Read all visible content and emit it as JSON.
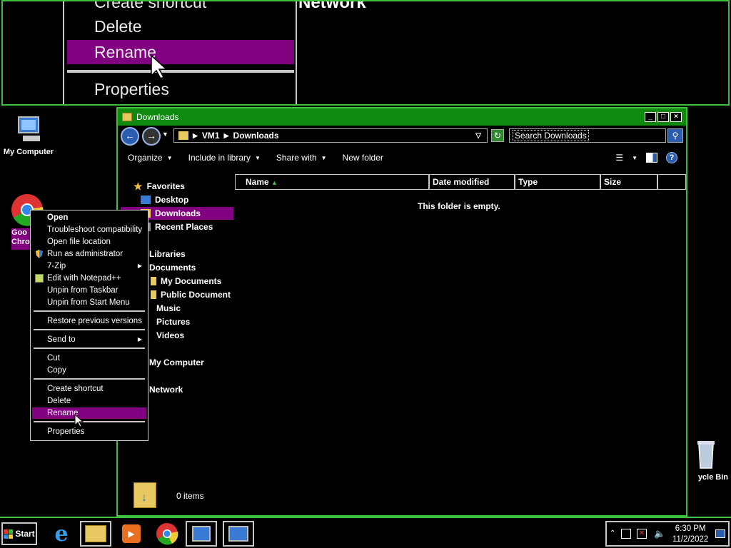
{
  "magnifier": {
    "items": [
      "Create shortcut",
      "Delete",
      "Rename",
      "Properties"
    ],
    "right_text": "Network"
  },
  "desktop": {
    "my_computer": "My Computer",
    "chrome_label": "Goo\nChro",
    "recycle_bin": "ycle Bin"
  },
  "window": {
    "title": "Downloads",
    "buttons": [
      "_",
      "□",
      "×"
    ],
    "address": {
      "root": "VM1",
      "folder": "Downloads"
    },
    "search_placeholder": "Search Downloads",
    "toolbar": {
      "organize": "Organize",
      "include": "Include in library",
      "share": "Share with",
      "new_folder": "New folder"
    },
    "nav": {
      "favorites": "Favorites",
      "desktop": "Desktop",
      "downloads": "Downloads",
      "recent": "Recent Places",
      "libraries": "Libraries",
      "documents": "Documents",
      "my_documents": "My Documents",
      "public_documents": "Public Document",
      "music": "Music",
      "pictures": "Pictures",
      "videos": "Videos",
      "my_computer": "My Computer",
      "network": "Network"
    },
    "columns": [
      "Name",
      "Date modified",
      "Type",
      "Size"
    ],
    "empty_message": "This folder is empty.",
    "status": "0 items"
  },
  "context_menu": {
    "open": "Open",
    "troubleshoot": "Troubleshoot compatibility",
    "open_location": "Open file location",
    "run_admin": "Run as administrator",
    "seven_zip": "7-Zip",
    "notepad": "Edit with Notepad++",
    "unpin_taskbar": "Unpin from Taskbar",
    "unpin_start": "Unpin from Start Menu",
    "restore": "Restore previous versions",
    "send_to": "Send to",
    "cut": "Cut",
    "copy": "Copy",
    "create_shortcut": "Create shortcut",
    "delete": "Delete",
    "rename": "Rename",
    "properties": "Properties"
  },
  "taskbar": {
    "start": "Start",
    "time": "6:30 PM",
    "date": "11/2/2022"
  },
  "colors": {
    "highlight": "#800080",
    "border_green": "#3fbf3f",
    "title_green": "#0f8a0f"
  }
}
